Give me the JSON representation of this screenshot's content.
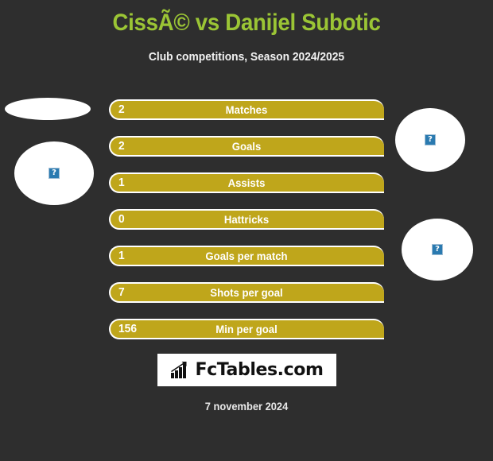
{
  "header": {
    "title": "CissÃ© vs Danijel Subotic",
    "subtitle": "Club competitions, Season 2024/2025",
    "title_color": "#9bc535"
  },
  "players": {
    "left": {
      "top_placeholder_icon": "broken-image-icon",
      "main_placeholder_icon": "broken-image-icon",
      "placeholder_glyph": "?"
    },
    "right": {
      "top_placeholder_icon": "broken-image-icon",
      "main_placeholder_icon": "broken-image-icon",
      "placeholder_glyph": "?"
    }
  },
  "stats": {
    "bar_color": "#bfa61b",
    "rows": [
      {
        "value": "2",
        "label": "Matches"
      },
      {
        "value": "2",
        "label": "Goals"
      },
      {
        "value": "1",
        "label": "Assists"
      },
      {
        "value": "0",
        "label": "Hattricks"
      },
      {
        "value": "1",
        "label": "Goals per match"
      },
      {
        "value": "7",
        "label": "Shots per goal"
      },
      {
        "value": "156",
        "label": "Min per goal"
      }
    ]
  },
  "footer": {
    "logo_icon": "bar-chart-growth-icon",
    "logo_text": "FcTables.com",
    "date": "7 november 2024"
  },
  "chart_data": {
    "type": "bar",
    "title": "CissÃ© vs Danijel Subotic",
    "subtitle": "Club competitions, Season 2024/2025",
    "categories": [
      "Matches",
      "Goals",
      "Assists",
      "Hattricks",
      "Goals per match",
      "Shots per goal",
      "Min per goal"
    ],
    "values": [
      2,
      2,
      1,
      0,
      1,
      7,
      156
    ],
    "xlabel": "",
    "ylabel": "",
    "legend": [],
    "grid": false,
    "orientation": "horizontal",
    "note": "All bars rendered at full width; numeric value printed at the left end of each bar."
  }
}
